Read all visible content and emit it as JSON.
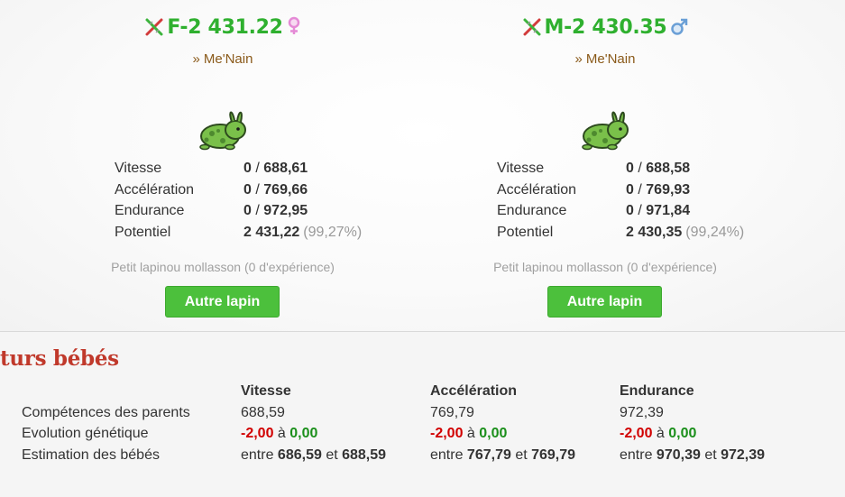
{
  "colors": {
    "name_green": "#2fb02f",
    "owner_brown": "#8a5a1a",
    "button_green": "#4cc03c",
    "title_red": "#c0392b",
    "negative_red": "#d10000",
    "positive_green": "#1a8f1a"
  },
  "rabbits": [
    {
      "name": "F-2 431.22",
      "dna_icon": "dna-icon",
      "sex_icon": "female-symbol-icon",
      "owner_prefix": "»",
      "owner": "Me'Nain",
      "stats": [
        {
          "label": "Vitesse",
          "current": "0",
          "sep": "/",
          "max": "688,61",
          "pct": ""
        },
        {
          "label": "Accélération",
          "current": "0",
          "sep": "/",
          "max": "769,66",
          "pct": ""
        },
        {
          "label": "Endurance",
          "current": "0",
          "sep": "/",
          "max": "972,95",
          "pct": ""
        },
        {
          "label": "Potentiel",
          "current": "",
          "sep": "",
          "max": "2 431,22",
          "pct": "(99,27%)"
        }
      ],
      "experience": "Petit lapinou mollasson (0 d'expérience)",
      "button": "Autre lapin"
    },
    {
      "name": "M-2 430.35",
      "dna_icon": "dna-icon",
      "sex_icon": "male-symbol-icon",
      "owner_prefix": "»",
      "owner": "Me'Nain",
      "stats": [
        {
          "label": "Vitesse",
          "current": "0",
          "sep": "/",
          "max": "688,58",
          "pct": ""
        },
        {
          "label": "Accélération",
          "current": "0",
          "sep": "/",
          "max": "769,93",
          "pct": ""
        },
        {
          "label": "Endurance",
          "current": "0",
          "sep": "/",
          "max": "971,84",
          "pct": ""
        },
        {
          "label": "Potentiel",
          "current": "",
          "sep": "",
          "max": "2 430,35",
          "pct": "(99,24%)"
        }
      ],
      "experience": "Petit lapinou mollasson (0 d'expérience)",
      "button": "Autre lapin"
    }
  ],
  "babies": {
    "title": "turs bébés",
    "columns": [
      "Vitesse",
      "Accélération",
      "Endurance"
    ],
    "rows": {
      "parents": {
        "label": "Compétences des parents",
        "values": [
          "688,59",
          "769,79",
          "972,39"
        ]
      },
      "evolution": {
        "label": "Evolution génétique",
        "connector": "à",
        "min": [
          "-2,00",
          "-2,00",
          "-2,00"
        ],
        "max": [
          "0,00",
          "0,00",
          "0,00"
        ]
      },
      "estimate": {
        "label": "Estimation des bébés",
        "prefix": "entre",
        "connector": "et",
        "min": [
          "686,59",
          "767,79",
          "970,39"
        ],
        "max": [
          "688,59",
          "769,79",
          "972,39"
        ]
      }
    }
  }
}
